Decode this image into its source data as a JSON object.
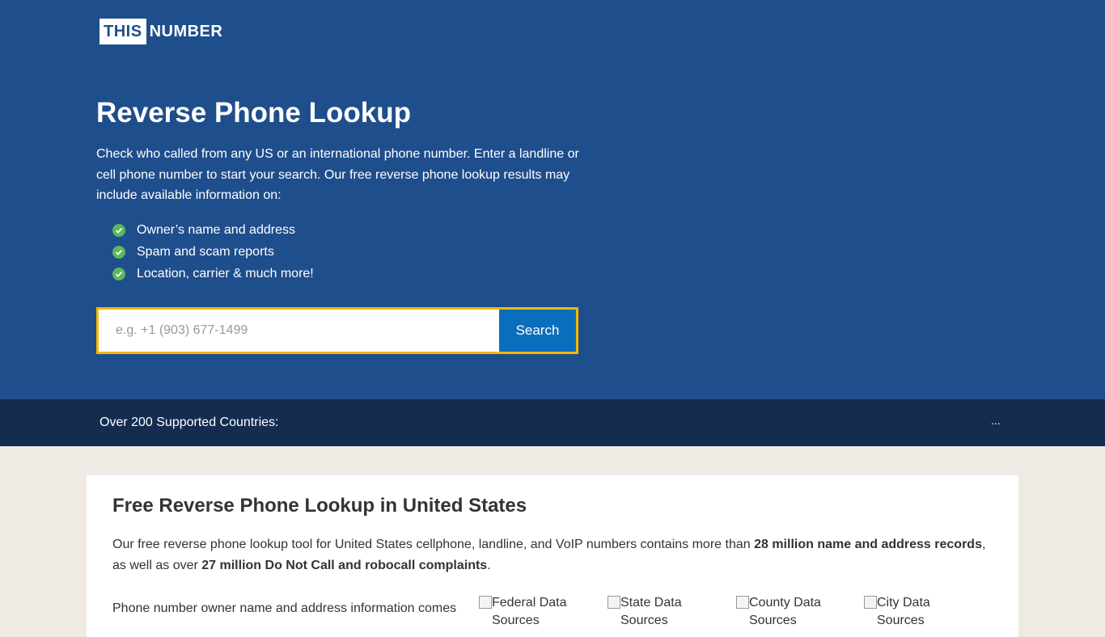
{
  "logo": {
    "box_text": "THIS",
    "text": "NUMBER"
  },
  "hero": {
    "title": "Reverse Phone Lookup",
    "description": "Check who called from any US or an international phone number. Enter a landline or cell phone number to start your search. Our free reverse phone lookup results may include available information on:",
    "features": [
      "Owner’s name and address",
      "Spam and scam reports",
      "Location, carrier & much more!"
    ]
  },
  "search": {
    "placeholder": "e.g. +1 (903) 677-1499",
    "button_label": "Search"
  },
  "countries": {
    "label": "Over 200 Supported Countries:",
    "more": "..."
  },
  "card": {
    "title": "Free Reverse Phone Lookup in United States",
    "desc_1": "Our free reverse phone lookup tool for United States cellphone, landline, and VoIP numbers contains more than ",
    "desc_bold_1": "28 million name and address records",
    "desc_2": ", as well as over ",
    "desc_bold_2": "27 million Do Not Call and robocall complaints",
    "desc_3": ".",
    "owner_text": "Phone number owner name and address information comes",
    "sources": [
      "Federal Data Sources",
      "State Data Sources",
      "County Data Sources",
      "City Data Sources"
    ]
  },
  "colors": {
    "hero_bg": "#1f4e8c",
    "bar_bg": "#142c50",
    "accent": "#f5b800",
    "button": "#0a6ebd",
    "check": "#5cb85c"
  }
}
